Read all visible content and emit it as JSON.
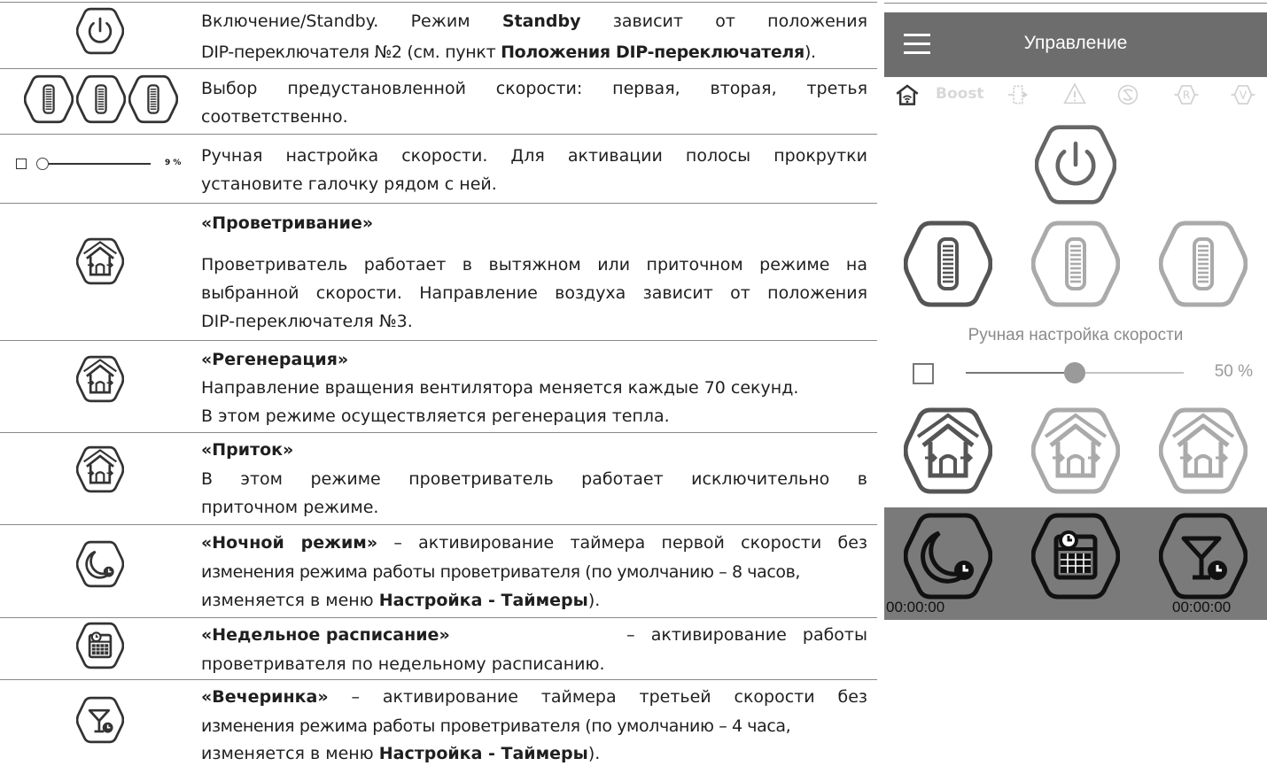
{
  "rows": [
    {
      "type": "plain",
      "html_parts": null,
      "line1": [
        "Включение/Standby. Режим ",
        "Standby",
        " зависит от положения"
      ],
      "line2": [
        "DIP-переключателя №2 (см. пункт ",
        "Положения DIP-переключателя",
        ")."
      ]
    },
    {
      "line1": "Выбор предустановленной скорости: первая, вторая, третья",
      "line2": "соответственно."
    },
    {
      "line1": "Ручная настройка скорости. Для активации полосы прокрутки",
      "line2": "установите галочку рядом с ней.",
      "slider_value": "9 %"
    },
    {
      "title": "«Проветривание»",
      "line1": "Проветриватель работает в вытяжном или приточном режиме на",
      "line2": "выбранной скорости. Направление воздуха зависит от положения",
      "line3": "DIP-переключателя №3."
    },
    {
      "title": "«Регенерация»",
      "line1": "Направление вращения вентилятора меняется каждые 70 секунд.",
      "line2": "В этом режиме осуществляется регенерация тепла."
    },
    {
      "title": "«Приток»",
      "line1": "В этом режиме проветриватель работает исключительно в",
      "line2": "приточном режиме."
    },
    {
      "title": "«Ночной режим»",
      "line1_rest": " – активирование таймера первой скорости без",
      "line2": "изменения режима работы проветривателя (по умолчанию – 8 часов,",
      "line3_pre": "изменяется в меню ",
      "line3_bold": "Настройка - Таймеры",
      "line3_post": ")."
    },
    {
      "title": "«Недельное расписание»",
      "line1_rest": "–   активирование   работы",
      "line2": "проветривателя по недельному расписанию."
    },
    {
      "title": "«Вечеринка»",
      "line1_rest": " – активирование таймера третьей скорости без",
      "line2": "изменения режима работы проветривателя (по умолчанию – 4 часа,",
      "line3_pre": "изменяется в меню ",
      "line3_bold": "Настройка - Таймеры",
      "line3_post": ")."
    }
  ],
  "phone": {
    "header_title": "Управление",
    "status_boost": "Boost",
    "manual_label": "Ручная настройка скорости",
    "speed_percent": "50 %",
    "speed_value_fraction": 0.5,
    "timer_left": "00:00:00",
    "timer_right": "00:00:00"
  },
  "colors": {
    "header": "#6d6d6d",
    "bottom_panel": "#7a7a7a",
    "icon_dark": "#333333",
    "icon_light": "#9a9a9a"
  },
  "icons": [
    "power-icon",
    "speed-1-icon",
    "speed-2-icon",
    "speed-3-icon",
    "checkbox-icon",
    "slider-icon",
    "ventilation-mode-icon",
    "regeneration-mode-icon",
    "supply-mode-icon",
    "night-mode-icon",
    "weekly-schedule-icon",
    "party-mode-icon",
    "menu-icon",
    "home-wifi-icon",
    "boost-label",
    "fan-icon",
    "alert-icon",
    "filter-icon",
    "r-icon",
    "v-icon"
  ]
}
